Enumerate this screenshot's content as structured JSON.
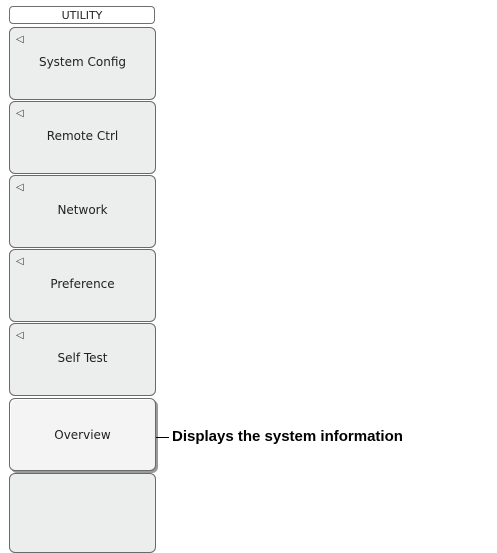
{
  "menu": {
    "title": "UTILITY",
    "items": [
      {
        "label": "System Config",
        "arrow": "◁"
      },
      {
        "label": "Remote Ctrl",
        "arrow": "◁"
      },
      {
        "label": "Network",
        "arrow": "◁"
      },
      {
        "label": "Preference",
        "arrow": "◁"
      },
      {
        "label": "Self Test",
        "arrow": "◁"
      },
      {
        "label": "Overview"
      },
      {
        "label": ""
      }
    ]
  },
  "callout": {
    "text": "Displays the system information"
  }
}
